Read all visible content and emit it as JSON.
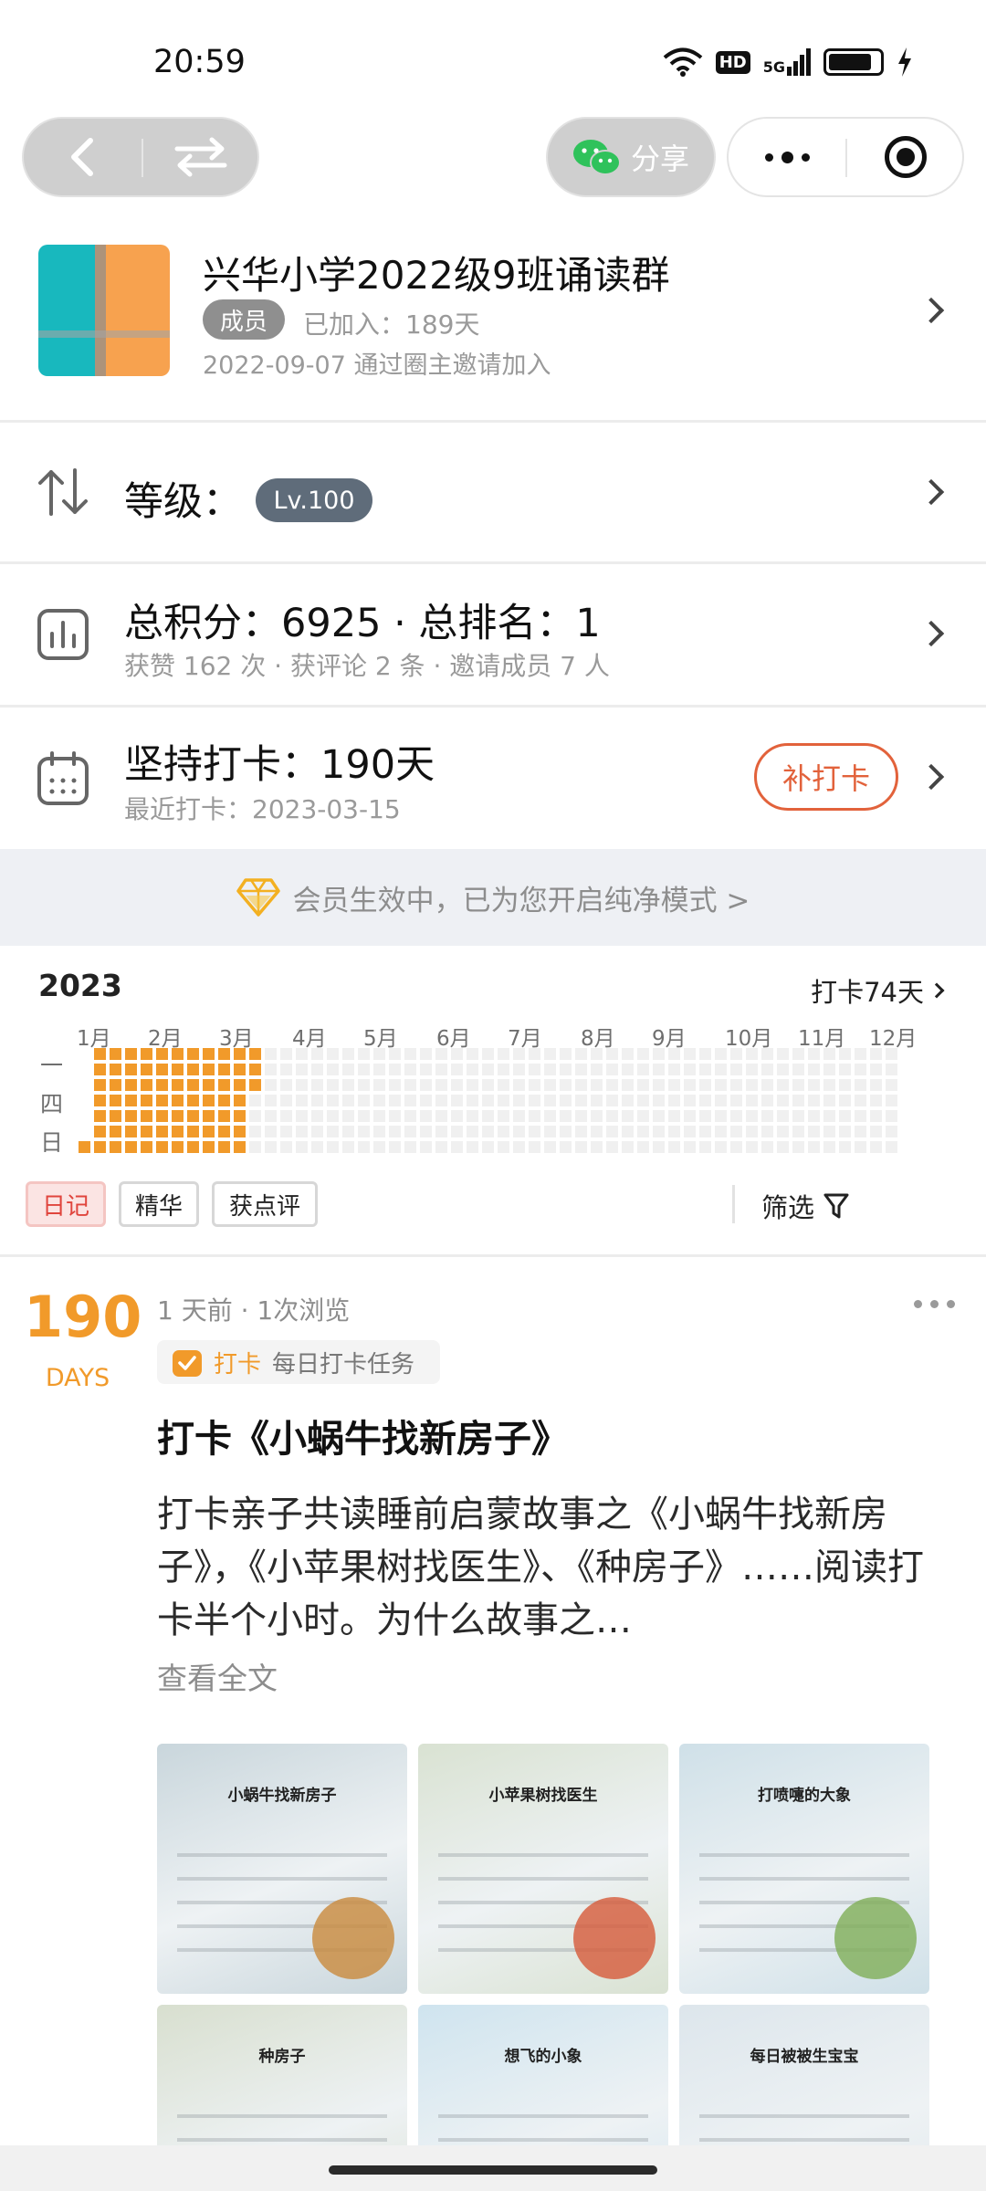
{
  "status_bar": {
    "time": "20:59",
    "hd": "HD",
    "network": "5G",
    "battery_level": 0.85
  },
  "nav": {
    "back_icon": "chevron-left-icon",
    "switch_icon": "switch-arrows-icon",
    "share_label": "分享",
    "share_icon": "wechat-icon",
    "more_icon": "more-dots-icon",
    "close_icon": "target-icon"
  },
  "group": {
    "title": "兴华小学2022级9班诵读群",
    "role": "成员",
    "joined_label": "已加入：189天",
    "join_info": "2022-09-07 通过圈主邀请加入",
    "accent_colors": [
      "#18b8be",
      "#f7a24f"
    ]
  },
  "level": {
    "label": "等级：",
    "value": "Lv.100"
  },
  "score": {
    "main": "总积分：6925 · 总排名：1",
    "sub": "获赞 162 次 · 获评论 2 条 · 邀请成员 7 人"
  },
  "checkin": {
    "main": "坚持打卡：190天",
    "sub": "最近打卡：2023-03-15",
    "makeup_label": "补打卡"
  },
  "vip": {
    "text": "会员生效中，已为您开启纯净模式 >"
  },
  "heatmap": {
    "year": "2023",
    "count_label": "打卡74天",
    "months": [
      "1月",
      "2月",
      "3月",
      "4月",
      "5月",
      "6月",
      "7月",
      "8月",
      "9月",
      "10月",
      "11月",
      "12月"
    ],
    "day_labels": [
      "一",
      "四",
      "日"
    ],
    "active_color": "#f19a2a",
    "empty_color": "#f0f0f0",
    "active_days": 74,
    "total_weeks": 53
  },
  "filters": {
    "tabs": [
      "日记",
      "精华",
      "获点评"
    ],
    "active": 0,
    "filter_label": "筛选"
  },
  "post": {
    "days": "190",
    "days_unit": "DAYS",
    "meta": "1 天前 · 1次浏览",
    "tag_type": "打卡",
    "tag_name": "每日打卡任务",
    "title": "打卡《小蜗牛找新房子》",
    "body": "打卡亲子共读睡前启蒙故事之《小蜗牛找新房子》，《小苹果树找医生》、《种房子》……阅读打卡半个小时。为什么故事之…",
    "read_more": "查看全文",
    "photos": [
      {
        "caption": "小蜗牛找新房子",
        "bg": "#c9d6dc",
        "accent": "#c98a3c"
      },
      {
        "caption": "小苹果树找医生",
        "bg": "#d9e2d2",
        "accent": "#d65a3a"
      },
      {
        "caption": "打喷嚏的大象",
        "bg": "#cfe0e8",
        "accent": "#7fae58"
      },
      {
        "caption": "种房子",
        "bg": "#d8dfcf",
        "accent": "#a8c070"
      },
      {
        "caption": "想飞的小象",
        "bg": "#cfe4ef",
        "accent": "#8a6a3c"
      },
      {
        "caption": "每日被被生宝宝",
        "bg": "#dde6ec",
        "accent": "#9fb4c4"
      }
    ]
  }
}
